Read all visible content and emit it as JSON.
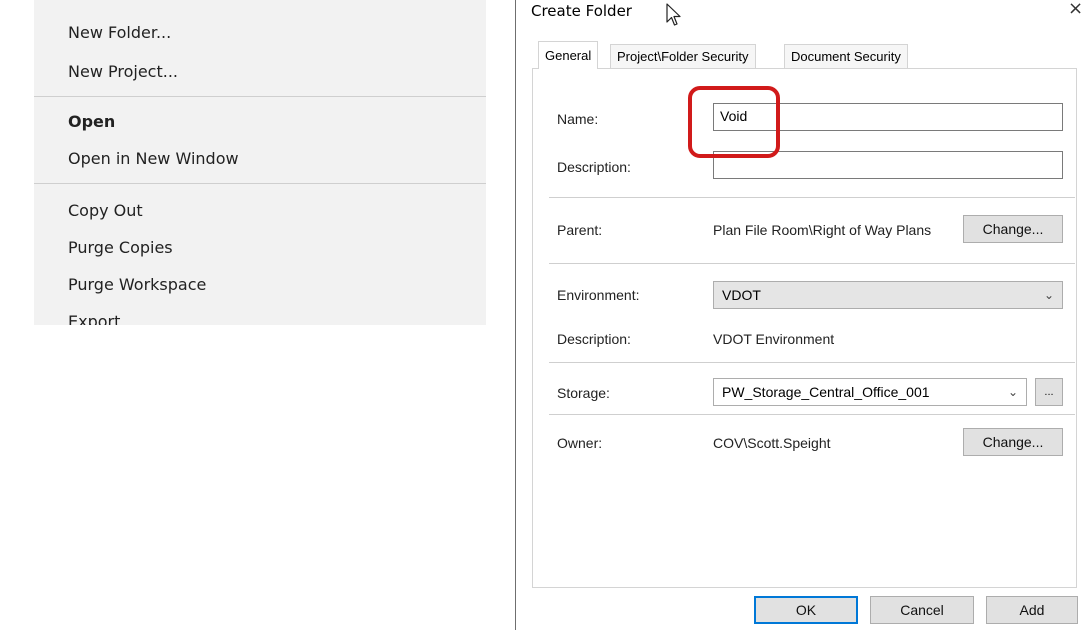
{
  "context_menu": {
    "items": [
      {
        "label": "New Folder..."
      },
      {
        "label": "New Project..."
      },
      {
        "label": "Open"
      },
      {
        "label": "Open in New Window"
      },
      {
        "label": "Copy Out"
      },
      {
        "label": "Purge Copies"
      },
      {
        "label": "Purge Workspace"
      },
      {
        "label": "Export"
      }
    ]
  },
  "dialog": {
    "title": "Create Folder",
    "close_label": "×",
    "tabs": [
      {
        "label": "General"
      },
      {
        "label": "Project\\Folder Security"
      },
      {
        "label": "Document Security"
      }
    ],
    "fields": {
      "name_label": "Name:",
      "name_value": "Void",
      "description_label": "Description:",
      "description_value": "",
      "parent_label": "Parent:",
      "parent_value": "Plan File Room\\Right of Way Plans",
      "environment_label": "Environment:",
      "environment_value": "VDOT",
      "env_description_label": "Description:",
      "env_description_value": "VDOT Environment",
      "storage_label": "Storage:",
      "storage_value": "PW_Storage_Central_Office_001",
      "owner_label": "Owner:",
      "owner_value": "COV\\Scott.Speight"
    },
    "buttons": {
      "change_parent": "Change...",
      "browse_storage": "...",
      "change_owner": "Change...",
      "ok": "OK",
      "cancel": "Cancel",
      "add": "Add"
    },
    "colors": {
      "highlight": "#d11a1a",
      "default_button_border": "#0078d7"
    }
  }
}
